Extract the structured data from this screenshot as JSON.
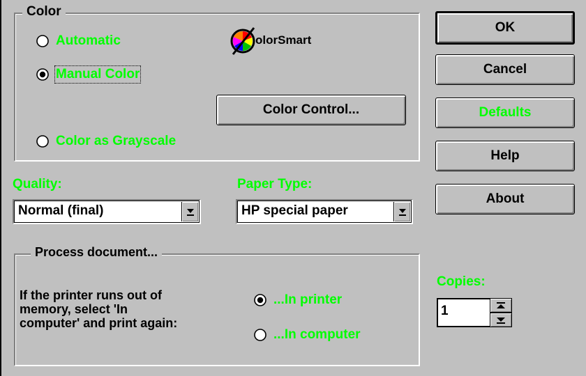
{
  "color_group": {
    "title": "Color",
    "automatic_label": "Automatic",
    "manual_label": "Manual Color",
    "grayscale_label": "Color as Grayscale",
    "color_control_label": "Color Control...",
    "logo_text": "olorSmart",
    "selected": "manual"
  },
  "quality": {
    "label": "Quality:",
    "value": "Normal (final)"
  },
  "paper_type": {
    "label": "Paper Type:",
    "value": "HP special paper"
  },
  "process_group": {
    "title": "Process document...",
    "description_lines": [
      "If the printer runs out of",
      "memory, select 'In",
      "computer' and print again:"
    ],
    "in_printer_label": "...In printer",
    "in_computer_label": "...In computer",
    "selected": "in_printer"
  },
  "buttons": {
    "ok": "OK",
    "cancel": "Cancel",
    "defaults": "Defaults",
    "help": "Help",
    "about": "About"
  },
  "copies": {
    "label": "Copies:",
    "value": "1"
  },
  "colors": {
    "face": "#c0c0c0",
    "accent_text": "#00ff00"
  }
}
